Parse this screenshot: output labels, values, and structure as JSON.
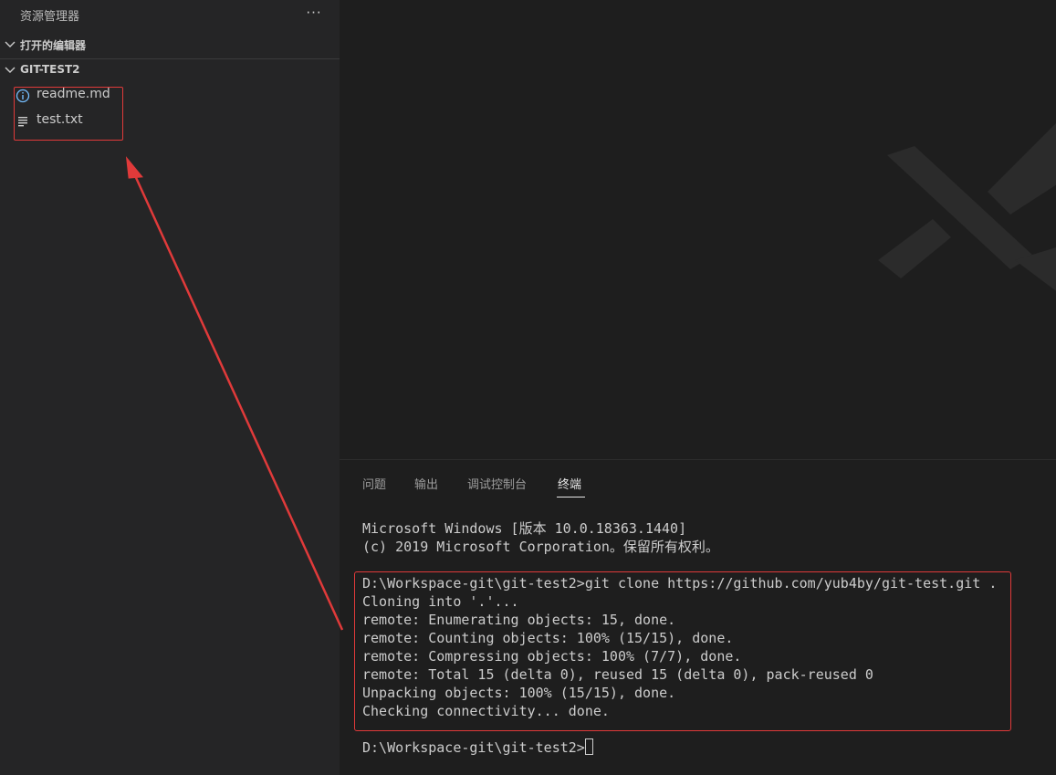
{
  "sidebar": {
    "title": "资源管理器",
    "more_icon": "ellipsis-icon",
    "open_editors_label": "打开的编辑器",
    "folder_label": "GIT-TEST2",
    "files": [
      {
        "name": "readme.md",
        "icon": "info-icon"
      },
      {
        "name": "test.txt",
        "icon": "text-file-icon"
      }
    ]
  },
  "panel": {
    "tabs": [
      {
        "label": "问题"
      },
      {
        "label": "输出"
      },
      {
        "label": "调试控制台"
      },
      {
        "label": "终端"
      }
    ],
    "active_tab": "终端"
  },
  "terminal": {
    "header_lines": [
      "Microsoft Windows [版本 10.0.18363.1440]",
      "(c) 2019 Microsoft Corporation。保留所有权利。"
    ],
    "output_lines": [
      "D:\\Workspace-git\\git-test2>git clone https://github.com/yub4by/git-test.git .",
      "Cloning into '.'...",
      "remote: Enumerating objects: 15, done.",
      "remote: Counting objects: 100% (15/15), done.",
      "remote: Compressing objects: 100% (7/7), done.",
      "remote: Total 15 (delta 0), reused 15 (delta 0), pack-reused 0",
      "Unpacking objects: 100% (15/15), done.",
      "Checking connectivity... done."
    ],
    "prompt": "D:\\Workspace-git\\git-test2>"
  },
  "colors": {
    "annotation": "#e03a3a",
    "sidebar_bg": "#252526",
    "editor_bg": "#1e1e1e",
    "info_icon": "#75beff"
  }
}
